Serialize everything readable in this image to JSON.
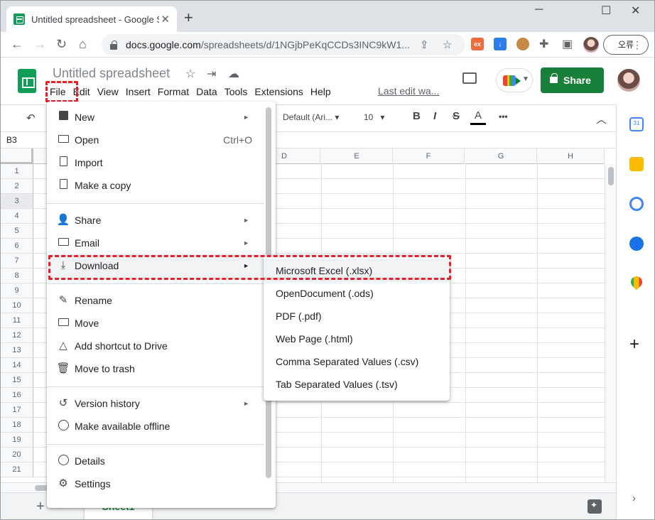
{
  "browser": {
    "tab_title": "Untitled spreadsheet - Google S",
    "tab_close": "✕",
    "new_tab": "+",
    "window_controls": [
      "─",
      "☐",
      "✕"
    ],
    "url_host": "docs.google.com",
    "url_path": "/spreadsheets/d/1NGjbPeKqCCDs3INC9kW1...",
    "profile_button": "오류",
    "extensions": [
      "ex"
    ]
  },
  "app": {
    "doc_title": "Untitled spreadsheet",
    "menu": [
      "File",
      "Edit",
      "View",
      "Insert",
      "Format",
      "Data",
      "Tools",
      "Extensions",
      "Help"
    ],
    "last_edit": "Last edit wa...",
    "share_label": "Share"
  },
  "toolbar": {
    "font": "Default (Ari...",
    "font_size": "10",
    "bold": "B",
    "italic": "I",
    "strike": "S",
    "text_color": "A",
    "more": "•••"
  },
  "grid": {
    "name_box": "B3",
    "columns": [
      "D",
      "E",
      "F",
      "G",
      "H"
    ],
    "rows": [
      "1",
      "2",
      "3",
      "4",
      "5",
      "6",
      "7",
      "8",
      "9",
      "10",
      "11",
      "12",
      "13",
      "14",
      "15",
      "16",
      "17",
      "18",
      "19",
      "20",
      "21"
    ]
  },
  "bottom": {
    "sheet_tab": "Sheet1"
  },
  "file_menu": {
    "items": [
      {
        "label": "New",
        "shortcut": "",
        "submenu": true,
        "icon": "plus-box-icon"
      },
      {
        "label": "Open",
        "shortcut": "Ctrl+O",
        "submenu": false,
        "icon": "folder-icon"
      },
      {
        "label": "Import",
        "shortcut": "",
        "submenu": false,
        "icon": "file-icon"
      },
      {
        "label": "Make a copy",
        "shortcut": "",
        "submenu": false,
        "icon": "copy-icon"
      },
      {
        "label": "Share",
        "shortcut": "",
        "submenu": true,
        "icon": "person-add-icon"
      },
      {
        "label": "Email",
        "shortcut": "",
        "submenu": true,
        "icon": "mail-icon"
      },
      {
        "label": "Download",
        "shortcut": "",
        "submenu": true,
        "icon": "download-icon"
      },
      {
        "label": "Rename",
        "shortcut": "",
        "submenu": false,
        "icon": "pencil-icon"
      },
      {
        "label": "Move",
        "shortcut": "",
        "submenu": false,
        "icon": "move-folder-icon"
      },
      {
        "label": "Add shortcut to Drive",
        "shortcut": "",
        "submenu": false,
        "icon": "drive-shortcut-icon"
      },
      {
        "label": "Move to trash",
        "shortcut": "",
        "submenu": false,
        "icon": "trash-icon"
      },
      {
        "label": "Version history",
        "shortcut": "",
        "submenu": true,
        "icon": "history-icon"
      },
      {
        "label": "Make available offline",
        "shortcut": "",
        "submenu": false,
        "icon": "offline-icon"
      },
      {
        "label": "Details",
        "shortcut": "",
        "submenu": false,
        "icon": "info-icon"
      },
      {
        "label": "Settings",
        "shortcut": "",
        "submenu": false,
        "icon": "gear-icon"
      }
    ],
    "submenu_arrow": "►"
  },
  "download_submenu": {
    "items": [
      "Microsoft Excel (.xlsx)",
      "OpenDocument (.ods)",
      "PDF (.pdf)",
      "Web Page (.html)",
      "Comma Separated Values (.csv)",
      "Tab Separated Values (.tsv)"
    ]
  },
  "colors": {
    "sheets_green": "#0f9d58",
    "share_green": "#188038",
    "highlight_red": "#e8202a"
  }
}
